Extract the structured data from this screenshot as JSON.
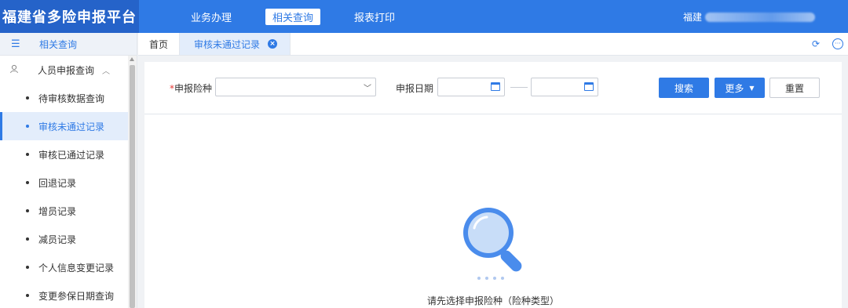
{
  "header": {
    "app_title": "福建省多险申报平台",
    "nav": [
      {
        "label": "业务办理",
        "active": false
      },
      {
        "label": "相关查询",
        "active": true
      },
      {
        "label": "报表打印",
        "active": false
      }
    ],
    "user_prefix": "福建"
  },
  "sidebar": {
    "title": "相关查询",
    "group": "人员申报查询",
    "items": [
      {
        "label": "待审核数据查询",
        "active": false
      },
      {
        "label": "审核未通过记录",
        "active": true
      },
      {
        "label": "审核已通过记录",
        "active": false
      },
      {
        "label": "回退记录",
        "active": false
      },
      {
        "label": "增员记录",
        "active": false
      },
      {
        "label": "减员记录",
        "active": false
      },
      {
        "label": "个人信息变更记录",
        "active": false
      },
      {
        "label": "变更参保日期查询",
        "active": false
      }
    ]
  },
  "tabs": [
    {
      "label": "首页",
      "active": false
    },
    {
      "label": "审核未通过记录",
      "active": true
    }
  ],
  "filter": {
    "insurance_label": "申报险种",
    "required_mark": "*",
    "insurance_value": "",
    "date_label": "申报日期",
    "date_start": "",
    "date_end": "",
    "search_label": "搜索",
    "more_label": "更多",
    "reset_label": "重置"
  },
  "empty_state": {
    "message": "请先选择申报险种（险种类型）"
  },
  "colors": {
    "primary": "#2f7ae5",
    "brand_bg": "#2563c9",
    "required": "#e53935"
  }
}
